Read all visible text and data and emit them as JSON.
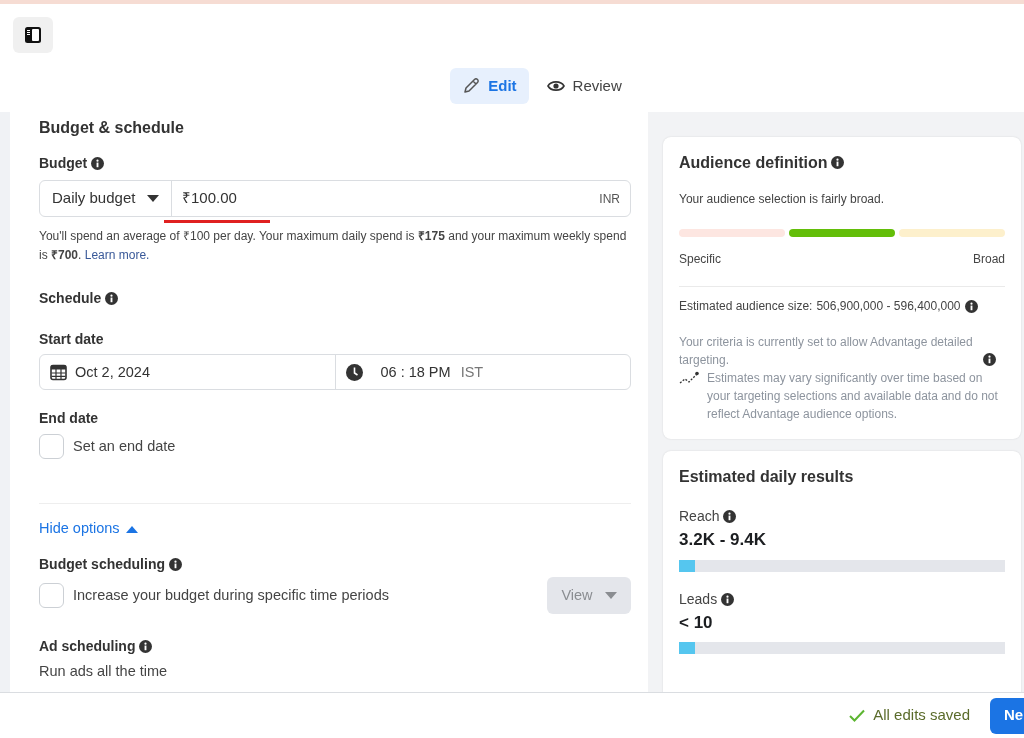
{
  "tabs": [
    {
      "label": "Edit",
      "selected": true
    },
    {
      "label": "Review",
      "selected": false
    }
  ],
  "budget_schedule": {
    "title": "Budget & schedule",
    "budget": {
      "label": "Budget",
      "type": "Daily budget",
      "value": "₹100.00",
      "currency": "INR",
      "note": "You'll spend an average of ₹100 per day. Your maximum daily spend is **₹175** and your maximum weekly spend is **₹700**.",
      "link": "Learn more."
    },
    "schedule": {
      "label": "Schedule",
      "start_label": "Start date",
      "start_date": "Oct 2, 2024",
      "start_time": "06 : 18 PM",
      "timezone": "IST",
      "end_label": "End date",
      "end_checkbox": {
        "label": "Set an end date",
        "checked": false
      }
    },
    "toggle": "Hide options",
    "budget_scheduling": {
      "label": "Budget scheduling",
      "checkbox": {
        "label": "Increase your budget during specific time periods",
        "checked": false
      },
      "button": "View",
      "disabled": true
    },
    "ad_scheduling": {
      "label": "Ad scheduling",
      "value": "Run ads all the time"
    }
  },
  "audience": {
    "title": "Audience definition",
    "summary": "Your audience selection is fairly broad.",
    "segments": [
      {
        "color": "#fde6e1"
      },
      {
        "color": "#63be09"
      },
      {
        "color": "#fdf0cc"
      }
    ],
    "low": "Specific",
    "high": "Broad",
    "size_label": "Estimated audience size:",
    "size": "506,900,000 - 596,400,000",
    "criteria": "Your criteria is currently set to allow Advantage detailed targeting.",
    "disclaimer": "Estimates may vary significantly over time based on your targeting selections and available data and do not reflect Advantage audience options."
  },
  "results": {
    "title": "Estimated daily results",
    "metrics": [
      {
        "label": "Reach",
        "value": "3.2K - 9.4K",
        "level": 0.05
      },
      {
        "label": "Leads",
        "value": "< 10",
        "level": 0.05
      }
    ]
  },
  "footer": {
    "status": "All edits saved",
    "next": "Ne"
  }
}
